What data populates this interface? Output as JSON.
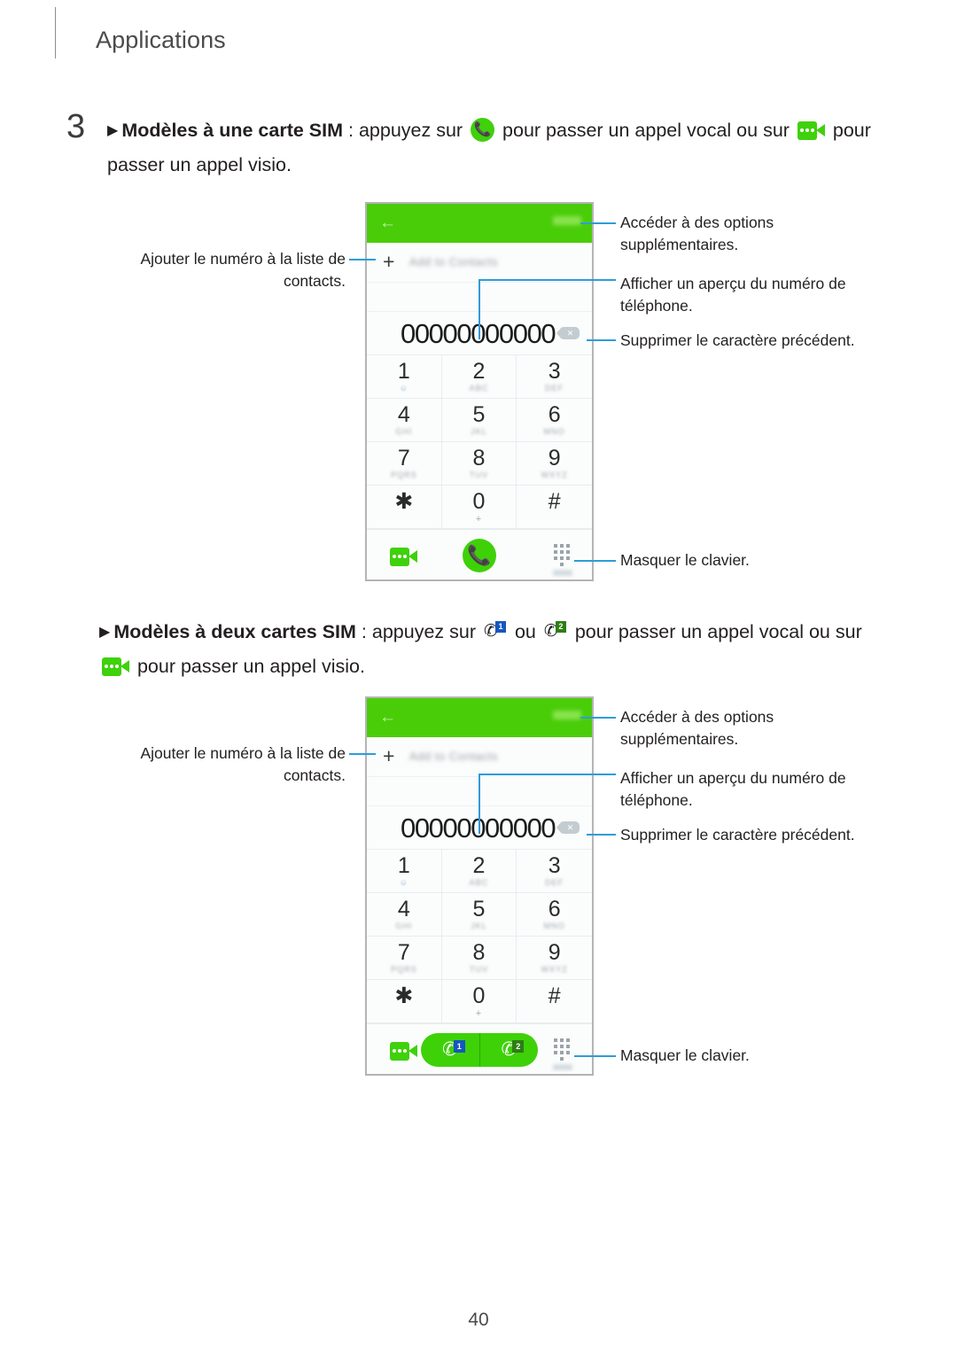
{
  "header": {
    "title": "Applications"
  },
  "steps": [
    {
      "number": "3",
      "arrow": "▶",
      "bold_lead": "Modèles à une carte SIM",
      "text_1": " : appuyez sur ",
      "icon_1": "call-circle-icon",
      "text_2": " pour passer un appel vocal ou sur ",
      "icon_2": "video-call-icon",
      "text_3": " pour passer un appel visio."
    }
  ],
  "paragraph_dual": {
    "arrow": "▶",
    "bold_lead": "Modèles à deux cartes SIM",
    "text_1": " : appuyez sur ",
    "icon_1": "sim1-call-icon",
    "text_2": " ou ",
    "icon_2": "sim2-call-icon",
    "text_3": " pour passer un appel vocal ou sur ",
    "icon_3": "video-call-icon",
    "text_4": " pour passer un appel visio."
  },
  "phone": {
    "back_icon": "←",
    "add_contact_label": "Add to Contacts",
    "plus_icon": "+",
    "dialed_number": "00000000000",
    "delete_glyph": "✕",
    "keys": [
      {
        "digit": "1",
        "sub": "∞",
        "sub_type": "voicemail"
      },
      {
        "digit": "2",
        "sub": "ABC",
        "sub_type": "letters"
      },
      {
        "digit": "3",
        "sub": "DEF",
        "sub_type": "letters"
      },
      {
        "digit": "4",
        "sub": "GHI",
        "sub_type": "letters"
      },
      {
        "digit": "5",
        "sub": "JKL",
        "sub_type": "letters"
      },
      {
        "digit": "6",
        "sub": "MNO",
        "sub_type": "letters"
      },
      {
        "digit": "7",
        "sub": "PQRS",
        "sub_type": "letters"
      },
      {
        "digit": "8",
        "sub": "TUV",
        "sub_type": "letters"
      },
      {
        "digit": "9",
        "sub": "WXYZ",
        "sub_type": "letters"
      },
      {
        "digit": "✱",
        "sub": "",
        "sub_type": "none"
      },
      {
        "digit": "0",
        "sub": "+",
        "sub_type": "plus"
      },
      {
        "digit": "#",
        "sub": "",
        "sub_type": "none"
      }
    ],
    "handset_glyph": "✆",
    "sim1_badge": "1",
    "sim2_badge": "2"
  },
  "callouts": {
    "add_to_contacts": "Ajouter le numéro à la liste de contacts.",
    "more_options": "Accéder à des options supplémentaires.",
    "preview_number": "Afficher un aperçu du numéro de téléphone.",
    "delete_char": "Supprimer le caractère précédent.",
    "hide_keypad": "Masquer le clavier."
  },
  "footer": {
    "page_number": "40"
  },
  "colors": {
    "accent_green": "#4ACD09",
    "call_button_green": "#3ED108",
    "leader_blue": "#2e9cd8",
    "sim1_badge": "#1557c0",
    "sim2_badge": "#2e7d16",
    "text": "#231f20"
  }
}
